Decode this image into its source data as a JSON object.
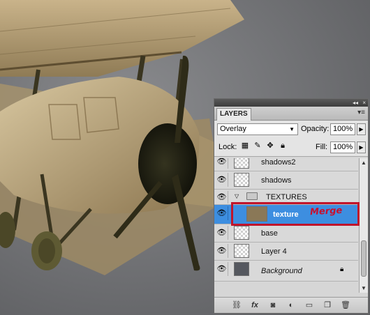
{
  "panel": {
    "tab_label": "LAYERS",
    "collapse_glyph": "◂◂",
    "close_glyph": "×",
    "menu_glyph": "▾≡"
  },
  "blend": {
    "mode": "Overlay",
    "opacity_label": "Opacity:",
    "opacity_value": "100%",
    "lock_label": "Lock:",
    "fill_label": "Fill:",
    "fill_value": "100%"
  },
  "layers": [
    {
      "name": "shadows2",
      "type": "layer"
    },
    {
      "name": "shadows",
      "type": "layer"
    },
    {
      "name": "TEXTURES",
      "type": "group",
      "expanded": true
    },
    {
      "name": "texture",
      "type": "layer",
      "selected": true
    },
    {
      "name": "base",
      "type": "layer"
    },
    {
      "name": "Layer 4",
      "type": "layer"
    },
    {
      "name": "Background",
      "type": "background",
      "locked": true
    }
  ],
  "annotation": {
    "text": "Merge",
    "color": "#c8102e"
  },
  "footer_icons": [
    "link-icon",
    "fx-icon",
    "mask-icon",
    "adjustment-icon",
    "folder-icon",
    "new-layer-icon",
    "trash-icon"
  ],
  "colors": {
    "selection": "#3d8ee0",
    "highlight": "#c0142b",
    "backdrop": "#6e6f72"
  }
}
